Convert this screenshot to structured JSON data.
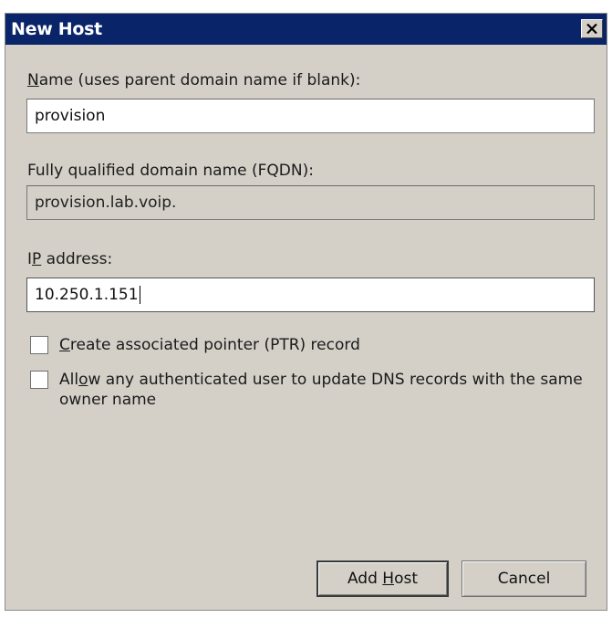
{
  "window": {
    "title": "New Host",
    "close_icon": "close-icon"
  },
  "name_field": {
    "label_access_key": "N",
    "label_rest": "ame (uses parent domain name if blank):",
    "value": "provision"
  },
  "fqdn_field": {
    "label": "Fully qualified domain name (FQDN):",
    "value": "provision.lab.voip."
  },
  "ip_field": {
    "label_access_key": "P",
    "label_prefix": "I",
    "label_rest": " address:",
    "value": "10.250.1.151"
  },
  "ptr_checkbox": {
    "checked": false,
    "label_access_key": "C",
    "label_rest": "reate associated pointer (PTR) record"
  },
  "allow_update_checkbox": {
    "checked": false,
    "label_prefix": "All",
    "label_access_key": "o",
    "label_rest": "w any authenticated user to update DNS records with the same owner name"
  },
  "buttons": {
    "add_host_prefix": "Add ",
    "add_host_access_key": "H",
    "add_host_rest": "ost",
    "cancel": "Cancel"
  },
  "colors": {
    "titlebar": "#0a246a",
    "dialog_background": "#d4d0c8",
    "field_background": "#ffffff"
  }
}
